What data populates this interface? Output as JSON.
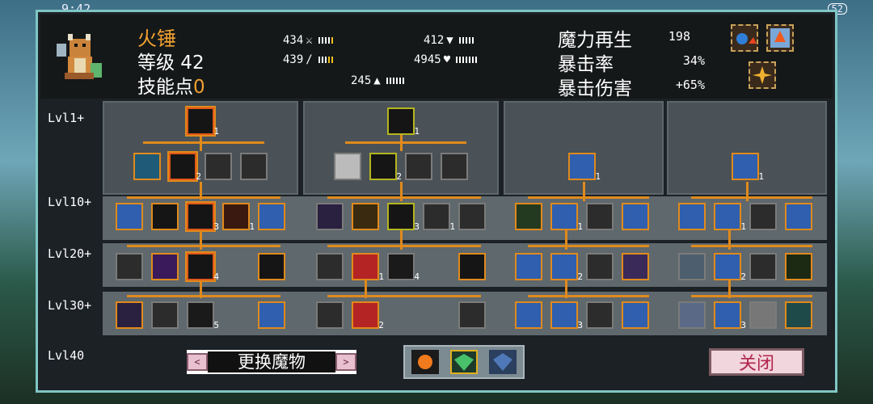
{
  "status_bar": {
    "time": "9:42",
    "battery": "52"
  },
  "hero": {
    "name": "火锤",
    "level_label": "等级 42",
    "skill_points_label": "技能点",
    "skill_points": "0",
    "portrait_icon": "dragon-warrior-icon"
  },
  "stats": [
    {
      "value": "434",
      "icon": "sword-icon"
    },
    {
      "value": "439",
      "icon": "staff-icon"
    },
    {
      "value": "245",
      "icon": "boot-icon"
    },
    {
      "value": "412",
      "icon": "shield-icon"
    },
    {
      "value": "4945",
      "icon": "heart-icon"
    }
  ],
  "right_stats": [
    {
      "label": "魔力再生",
      "value": "198"
    },
    {
      "label": "暴击率",
      "value": "34%"
    },
    {
      "label": "暴击伤害",
      "value": "+65%"
    }
  ],
  "row_labels": [
    "Lvl1+",
    "Lvl10+",
    "Lvl20+",
    "Lvl30+",
    "Lvl40"
  ],
  "node_levels": {
    "p1_top": "1",
    "p1_r2": "2",
    "p1_r3": "3",
    "p1_r3b": "1",
    "p1_r4": "4",
    "p1_r5": "5",
    "p2_top": "1",
    "p2_r2": "2",
    "p2_r3": "3",
    "p2_r3b": "1",
    "p2_r4a": "1",
    "p2_r4b": "4",
    "p2_r5": "2",
    "p3_top": "1",
    "p3_r3": "1",
    "p3_r4": "2",
    "p3_r5": "3",
    "p4_top": "1",
    "p4_r3": "1",
    "p4_r4": "2",
    "p4_r5": "3"
  },
  "swap_button": {
    "label": "更换魔物",
    "prev": "<",
    "next": ">"
  },
  "close_button": {
    "label": "关闭"
  }
}
